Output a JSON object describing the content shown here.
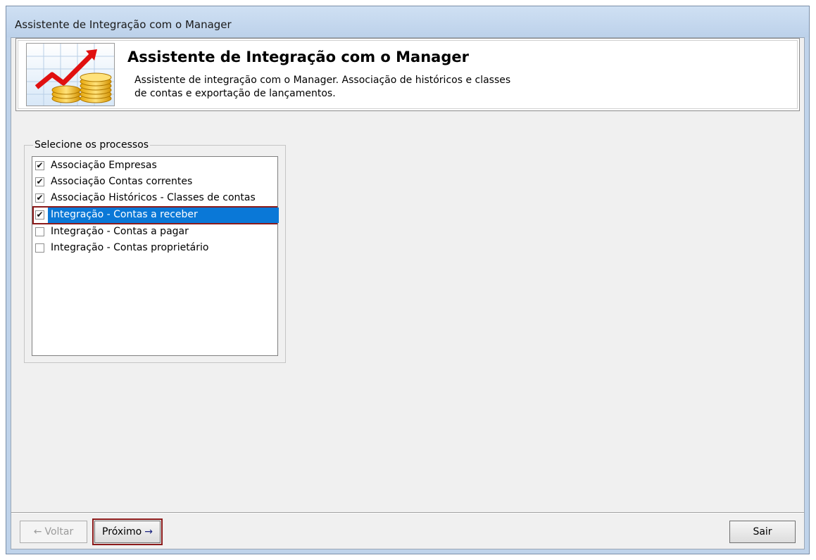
{
  "window": {
    "title": "Assistente de Integração com o Manager"
  },
  "header": {
    "title": "Assistente de Integração com o Manager",
    "description_line1": "Assistente de integração com o Manager. Associação de históricos e classes",
    "description_line2": "de contas e exportação de lançamentos."
  },
  "processes": {
    "group_label": "Selecione os processos",
    "items": [
      {
        "label": "Associação Empresas",
        "checked": true
      },
      {
        "label": "Associação Contas correntes",
        "checked": true
      },
      {
        "label": "Associação Históricos - Classes de contas",
        "checked": true
      },
      {
        "label": "Integração - Contas a receber",
        "checked": true,
        "selected": true
      },
      {
        "label": "Integração - Contas a pagar",
        "checked": false
      },
      {
        "label": "Integração - Contas proprietário",
        "checked": false
      }
    ]
  },
  "buttons": {
    "back": "Voltar",
    "next": "Próximo",
    "exit": "Sair"
  },
  "icons": {
    "back": "arrow-left-icon",
    "next": "arrow-right-icon",
    "logo": "chart-coins-icon"
  },
  "colors": {
    "selection": "#0a78d7",
    "highlight": "#8b1a1a"
  }
}
